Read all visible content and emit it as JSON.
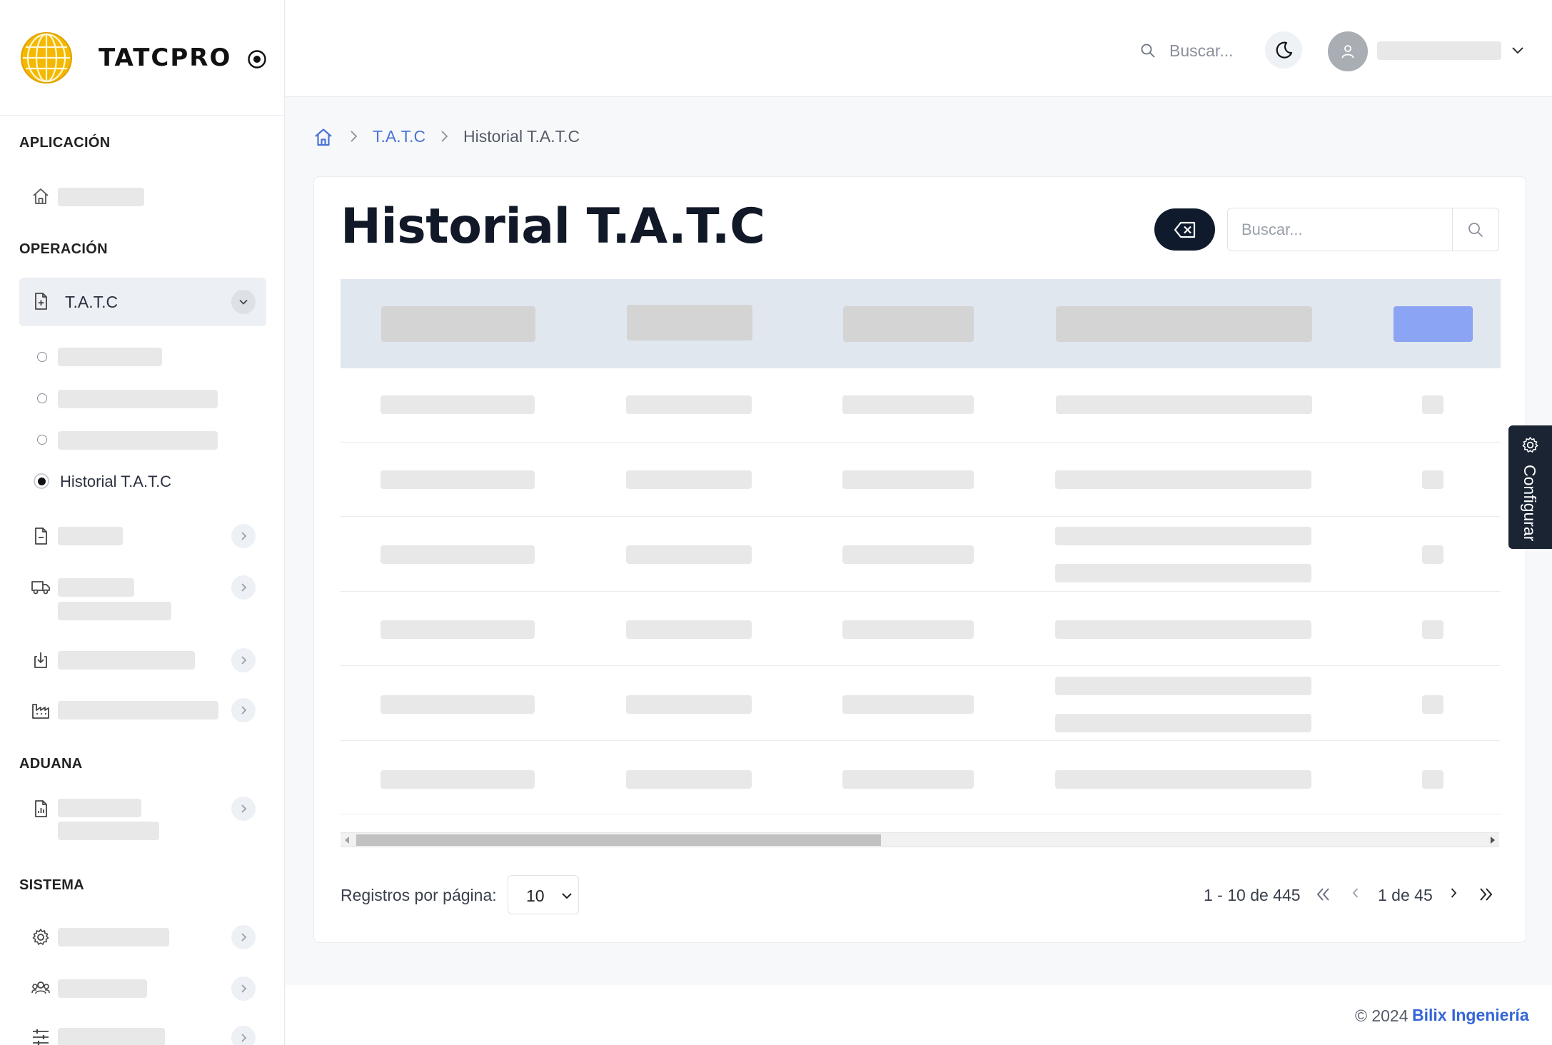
{
  "brand": {
    "name": "TATCPRO"
  },
  "sidebar": {
    "sections": {
      "app": "APLICACIÓN",
      "operation": "OPERACIÓN",
      "customs": "ADUANA",
      "system": "SISTEMA"
    },
    "active_item": {
      "label": "T.A.T.C",
      "icon": "file-plus-icon"
    },
    "active_subitem": {
      "label": "Historial T.A.T.C"
    }
  },
  "header": {
    "search_label": "Buscar..."
  },
  "breadcrumb": {
    "link": "T.A.T.C",
    "current": "Historial T.A.T.C"
  },
  "main": {
    "title": "Historial T.A.T.C",
    "search_placeholder": "Buscar..."
  },
  "pagination": {
    "per_page_label": "Registros por página:",
    "per_page_value": "10",
    "range": "1 - 10 de 445",
    "page": "1 de 45"
  },
  "footer": {
    "copyright": "© 2024",
    "company": "Bilix Ingeniería"
  },
  "config_tab": {
    "label": "Configurar"
  },
  "colors": {
    "accent": "#4a72d6",
    "header_row": "#e1e7ef",
    "dark_button": "#0f1b2d",
    "action_placeholder": "#8ba4f3",
    "logo_gold": "#f5b800"
  }
}
